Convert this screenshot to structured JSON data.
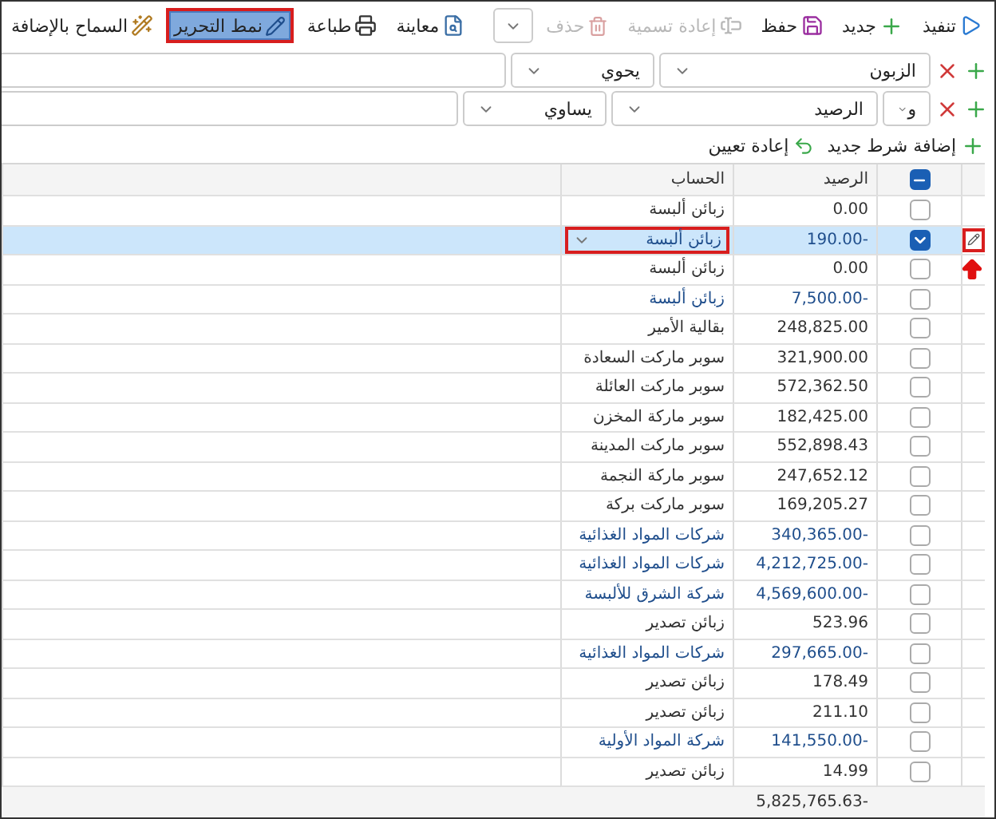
{
  "toolbar": {
    "actions": [
      {
        "label": "تنفيذ",
        "disabled": false
      },
      {
        "label": "جديد",
        "disabled": false
      },
      {
        "label": "حفظ",
        "disabled": false
      },
      {
        "label": "إعادة تسمية",
        "disabled": true
      },
      {
        "label": "حذف",
        "disabled": true
      }
    ],
    "view_actions": [
      {
        "label": "معاينة",
        "selected": false,
        "highlighted": false
      },
      {
        "label": "طباعة",
        "selected": false,
        "highlighted": false
      },
      {
        "label": "نمط التحرير",
        "selected": true,
        "highlighted": true
      },
      {
        "label": "السماح بالإضافة",
        "selected": false,
        "highlighted": false
      }
    ]
  },
  "filters": [
    {
      "field": "الزبون",
      "operator": "يحوي"
    },
    {
      "conjunction": "و",
      "field": "الرصيد",
      "operator": "يساوي"
    }
  ],
  "filter_actions": [
    {
      "label": "إضافة شرط جديد"
    },
    {
      "label": "إعادة تعيين"
    }
  ],
  "table": {
    "columns": [
      "الرصيد",
      "الحساب"
    ],
    "header_checkbox_partial": true,
    "rows": [
      {
        "balance": "0.00",
        "account": "زبائن ألبسة",
        "negative": false,
        "checked": false,
        "selected": false,
        "editing": false
      },
      {
        "balance": "190.00-",
        "account": "زبائن ألبسة",
        "negative": true,
        "checked": true,
        "selected": true,
        "editing": true
      },
      {
        "balance": "0.00",
        "account": "زبائن ألبسة",
        "negative": false,
        "checked": false,
        "selected": false,
        "editing": false
      },
      {
        "balance": "7,500.00-",
        "account": "زبائن ألبسة",
        "negative": true,
        "checked": false,
        "selected": false,
        "editing": false
      },
      {
        "balance": "248,825.00",
        "account": "بقالية الأمير",
        "negative": false,
        "checked": false,
        "selected": false,
        "editing": false
      },
      {
        "balance": "321,900.00",
        "account": "سوبر ماركت السعادة",
        "negative": false,
        "checked": false,
        "selected": false,
        "editing": false
      },
      {
        "balance": "572,362.50",
        "account": "سوبر ماركت العائلة",
        "negative": false,
        "checked": false,
        "selected": false,
        "editing": false
      },
      {
        "balance": "182,425.00",
        "account": "سوبر ماركة المخزن",
        "negative": false,
        "checked": false,
        "selected": false,
        "editing": false
      },
      {
        "balance": "552,898.43",
        "account": "سوبر ماركت المدينة",
        "negative": false,
        "checked": false,
        "selected": false,
        "editing": false
      },
      {
        "balance": "247,652.12",
        "account": "سوبر ماركة النجمة",
        "negative": false,
        "checked": false,
        "selected": false,
        "editing": false
      },
      {
        "balance": "169,205.27",
        "account": "سوبر ماركت بركة",
        "negative": false,
        "checked": false,
        "selected": false,
        "editing": false
      },
      {
        "balance": "340,365.00-",
        "account": "شركات المواد الغذائية",
        "negative": true,
        "checked": false,
        "selected": false,
        "editing": false
      },
      {
        "balance": "4,212,725.00-",
        "account": "شركات المواد الغذائية",
        "negative": true,
        "checked": false,
        "selected": false,
        "editing": false
      },
      {
        "balance": "4,569,600.00-",
        "account": "شركة الشرق للألبسة",
        "negative": true,
        "checked": false,
        "selected": false,
        "editing": false
      },
      {
        "balance": "523.96",
        "account": "زبائن تصدير",
        "negative": false,
        "checked": false,
        "selected": false,
        "editing": false
      },
      {
        "balance": "297,665.00-",
        "account": "شركات المواد الغذائية",
        "negative": true,
        "checked": false,
        "selected": false,
        "editing": false
      },
      {
        "balance": "178.49",
        "account": "زبائن تصدير",
        "negative": false,
        "checked": false,
        "selected": false,
        "editing": false
      },
      {
        "balance": "211.10",
        "account": "زبائن تصدير",
        "negative": false,
        "checked": false,
        "selected": false,
        "editing": false
      },
      {
        "balance": "141,550.00-",
        "account": "شركة المواد الأولية",
        "negative": true,
        "checked": false,
        "selected": false,
        "editing": false
      },
      {
        "balance": "14.99",
        "account": "زبائن تصدير",
        "negative": false,
        "checked": false,
        "selected": false,
        "editing": false
      }
    ],
    "total": "5,825,765.63-"
  }
}
